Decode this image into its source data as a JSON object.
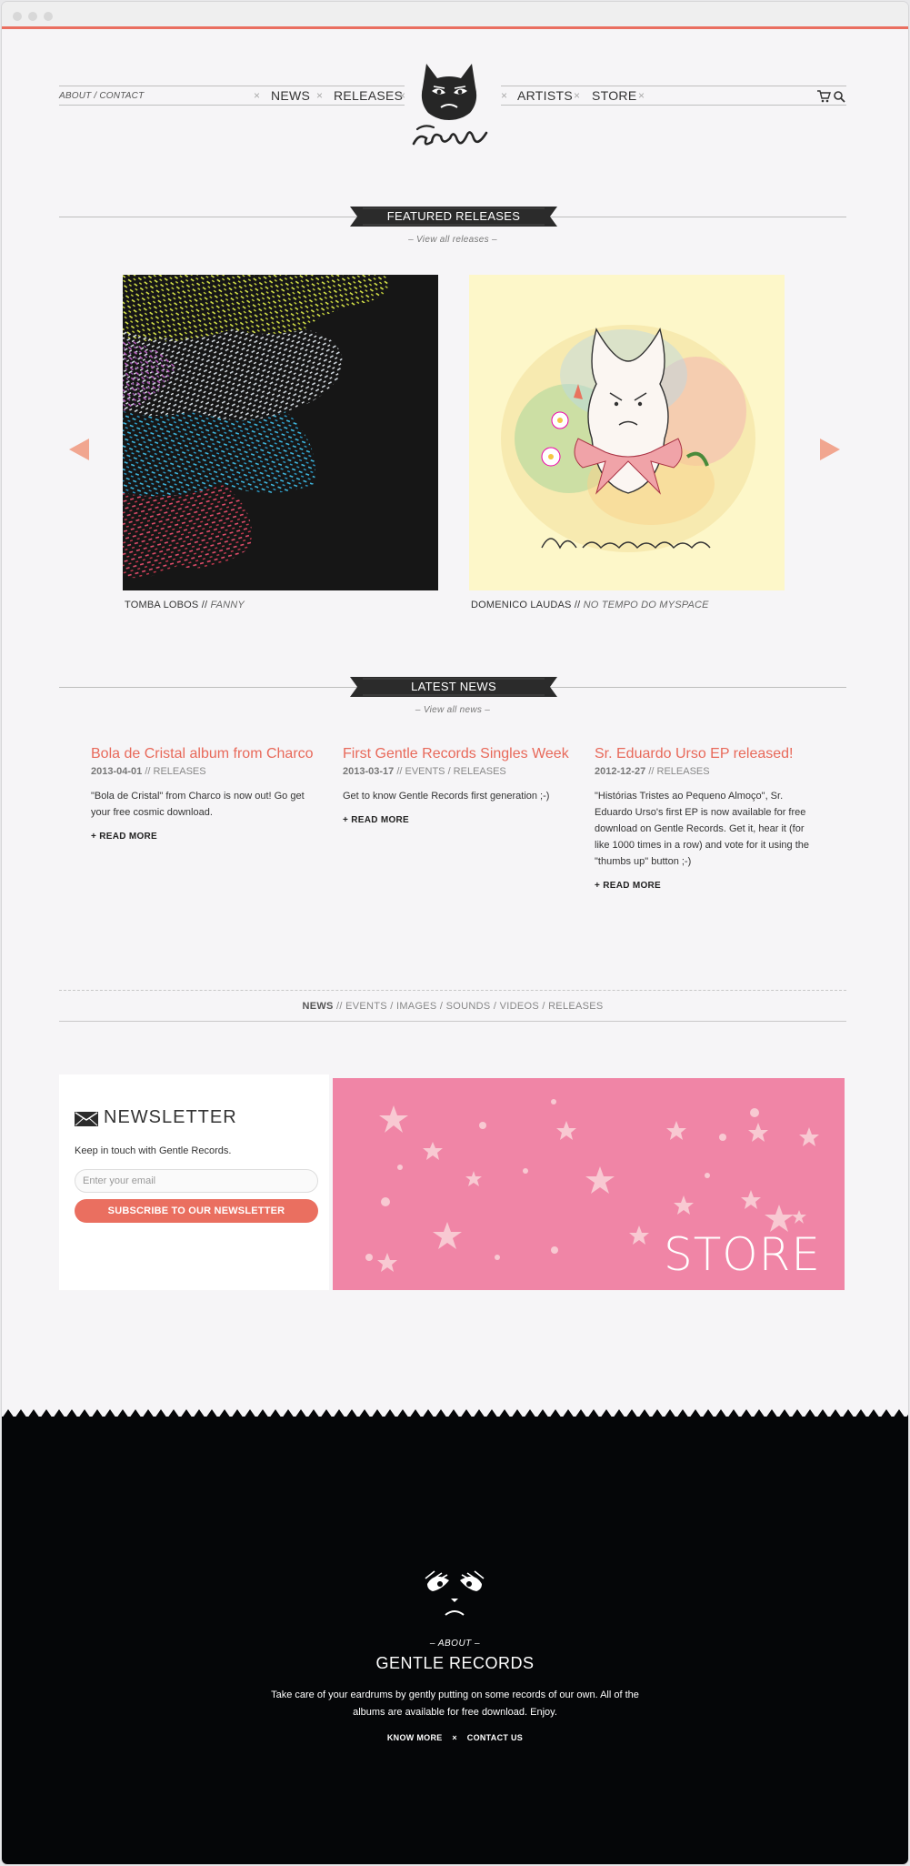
{
  "nav": {
    "about_contact": "About / Contact",
    "news": "News",
    "releases": "Releases",
    "artists": "Artists",
    "store": "Store",
    "separator": "×"
  },
  "featured": {
    "heading": "Featured Releases",
    "view_all": "– View all releases –",
    "items": [
      {
        "artist": "TOMBA LOBOS",
        "sep": " // ",
        "album": "FANNY"
      },
      {
        "artist": "DOMENICO LAUDAS",
        "sep": " // ",
        "album": "NO TEMPO DO MYSPACE",
        "cover_text": "Domenico Laudas"
      }
    ]
  },
  "latest_news": {
    "heading": "Latest News",
    "view_all": "– View all news –",
    "items": [
      {
        "title": "Bola de Cristal album from Charco",
        "date": "2013-04-01",
        "categories": " // RELEASES",
        "excerpt": "\"Bola de Cristal\" from Charco is now out! Go get your free cosmic download.",
        "more": "+ Read more"
      },
      {
        "title": "First Gentle Records Singles Week",
        "date": "2013-03-17",
        "categories": " // EVENTS / RELEASES",
        "excerpt": "Get to know Gentle Records first generation ;-)",
        "more": "+ Read more"
      },
      {
        "title": "Sr. Eduardo Urso EP released!",
        "date": "2012-12-27",
        "categories": " // RELEASES",
        "excerpt": "\"Histórias Tristes ao Pequeno Almoço\", Sr. Eduardo Urso's first EP is now available for free download on Gentle Records. Get it, hear it (for like 1000 times in a row) and vote for it using the \"thumbs up\" button ;-)",
        "more": "+ Read more"
      }
    ]
  },
  "filters": {
    "items": [
      "NEWS",
      "EVENTS",
      "IMAGES",
      "SOUNDS",
      "VIDEOS",
      "RELEASES"
    ],
    "first_sep": " // ",
    "sep": " / "
  },
  "newsletter": {
    "title": "Newsletter",
    "text": "Keep in touch with Gentle Records.",
    "placeholder": "Enter your email",
    "button": "Subscribe to our newsletter"
  },
  "store_banner": {
    "label": "STORE"
  },
  "footer": {
    "about": "– About –",
    "title": "Gentle Records",
    "description": "Take care of your eardrums by gently putting on some records of our own. All of the albums are available for free download. Enjoy.",
    "know_more": "Know more",
    "separator": "×",
    "contact": "Contact us"
  },
  "colors": {
    "accent": "#ea6f60",
    "background": "#f6f5f7",
    "store_pink": "#f085a6",
    "footer_bg": "#050608"
  }
}
